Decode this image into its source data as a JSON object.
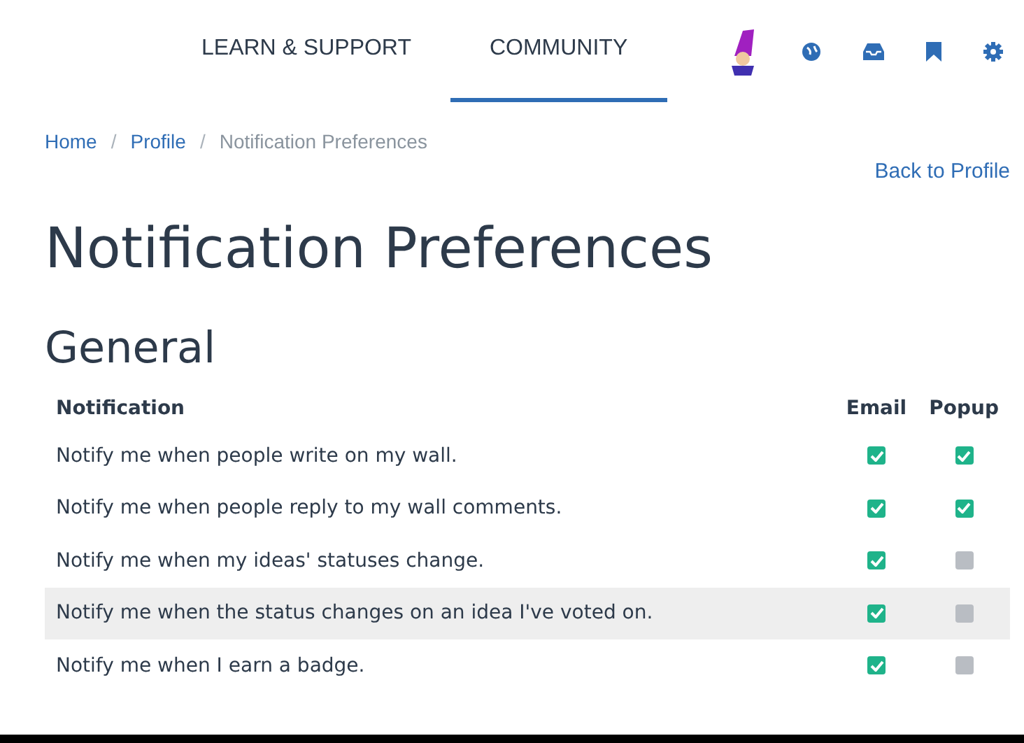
{
  "nav": {
    "tabs": [
      {
        "label": "LEARN & SUPPORT",
        "selected": false
      },
      {
        "label": "COMMUNITY",
        "selected": true
      }
    ]
  },
  "breadcrumb": [
    {
      "kind": "link",
      "label": "Home",
      "current": false
    },
    {
      "kind": "separator",
      "label": "/"
    },
    {
      "kind": "link",
      "label": "Profile",
      "current": false
    },
    {
      "kind": "separator",
      "label": "/"
    },
    {
      "kind": "link",
      "label": "Notification Preferences",
      "current": true
    }
  ],
  "back_link": "Back to Profile",
  "title": "Notification Preferences",
  "section": "General",
  "table": {
    "columns": [
      "Notification",
      "Email",
      "Popup"
    ],
    "rows": [
      {
        "label": "Notify me when people write on my wall.",
        "email": true,
        "popup": true,
        "highlighted": false
      },
      {
        "label": "Notify me when people reply to my wall comments.",
        "email": true,
        "popup": true,
        "highlighted": false
      },
      {
        "label": "Notify me when my ideas' statuses change.",
        "email": true,
        "popup": false,
        "highlighted": false
      },
      {
        "label": "Notify me when the status changes on an idea I've voted on.",
        "email": true,
        "popup": false,
        "highlighted": true
      },
      {
        "label": "Notify me when I earn a badge.",
        "email": true,
        "popup": false,
        "highlighted": false
      }
    ]
  }
}
